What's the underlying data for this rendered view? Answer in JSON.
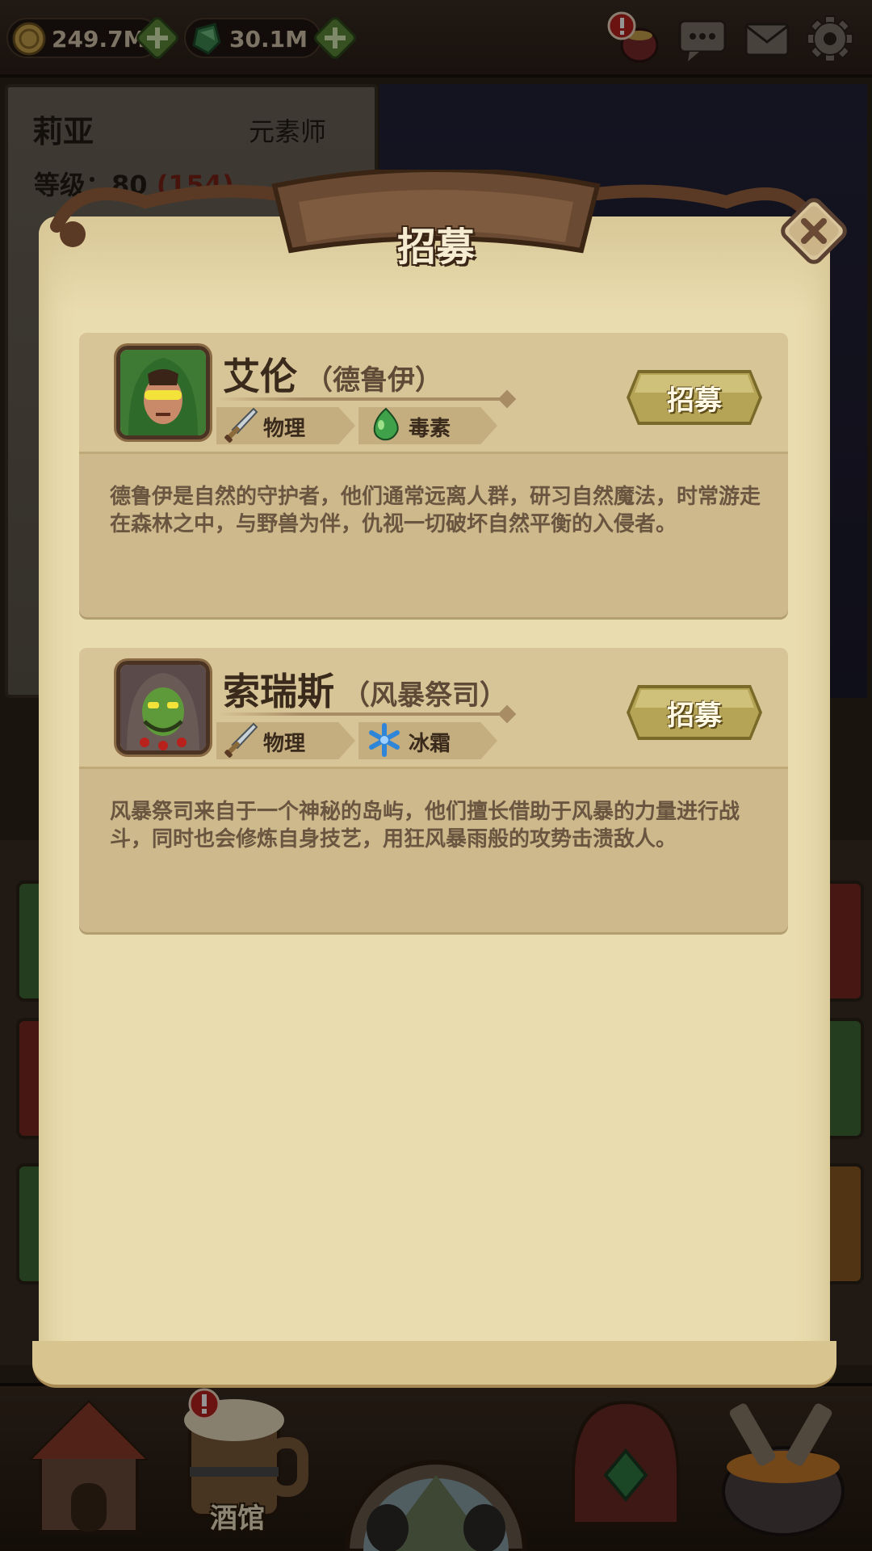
{
  "currencies": [
    {
      "icon": "gold-coin-icon",
      "value": "249.7M"
    },
    {
      "icon": "green-gem-icon",
      "value": "30.1M"
    }
  ],
  "top_icons": [
    "treasure-bag-icon",
    "chat-icon",
    "mail-icon",
    "settings-gear-icon"
  ],
  "character": {
    "name": "莉亚",
    "class": "元素师",
    "level_label": "等级：80",
    "level_extra": "(154)"
  },
  "modal": {
    "title": "招募",
    "close_icon": "close-x-icon"
  },
  "heroes": [
    {
      "name": "艾伦",
      "class": "（德鲁伊）",
      "portrait": "druid-portrait",
      "tags": [
        {
          "icon": "sword-icon",
          "label": "物理"
        },
        {
          "icon": "poison-drop-icon",
          "label": "毒素"
        }
      ],
      "recruit_label": "招募",
      "description": "德鲁伊是自然的守护者，他们通常远离人群，研习自然魔法，时常游走在森林之中，与野兽为伴，仇视一切破坏自然平衡的入侵者。"
    },
    {
      "name": "索瑞斯",
      "class": "（风暴祭司）",
      "portrait": "storm-priest-portrait",
      "tags": [
        {
          "icon": "sword-icon",
          "label": "物理"
        },
        {
          "icon": "snowflake-icon",
          "label": "冰霜"
        }
      ],
      "recruit_label": "招募",
      "description": "风暴祭司来自于一个神秘的岛屿，他们擅长借助于风暴的力量进行战斗，同时也会修炼自身技艺，用狂风暴雨般的攻势击溃敌人。"
    }
  ],
  "bottom_nav": {
    "tavern_label": "酒馆"
  },
  "colors": {
    "parchment": "#e9dcae",
    "card": "#cdb98c",
    "recruit_button": "#b5a455",
    "alert": "#b8211c"
  }
}
